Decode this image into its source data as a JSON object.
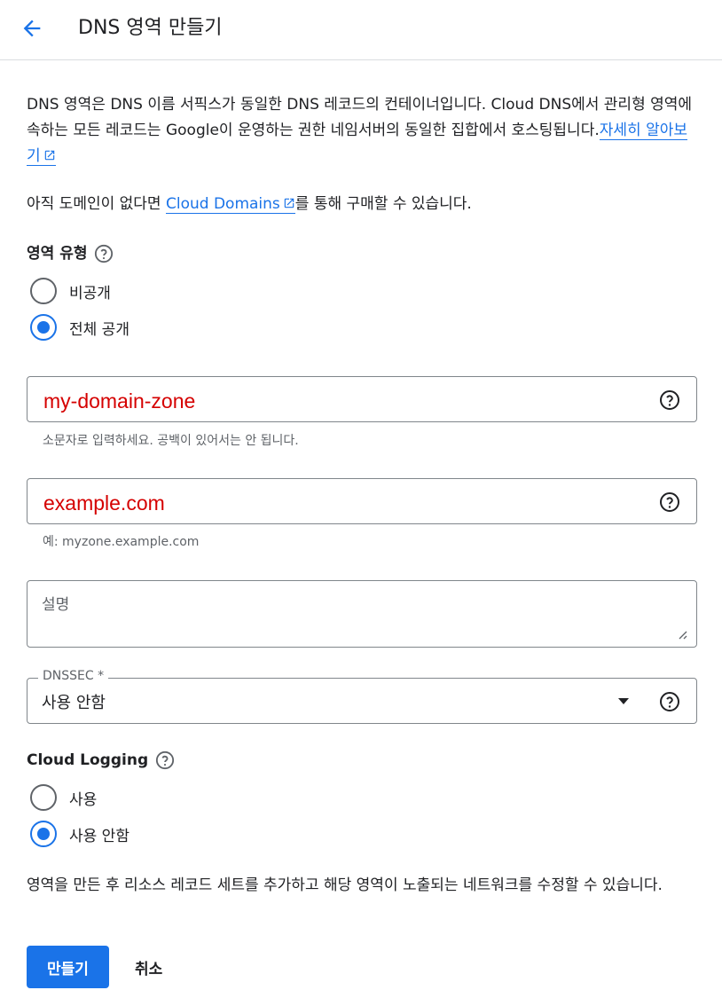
{
  "header": {
    "title": "DNS 영역 만들기"
  },
  "intro": {
    "text": "DNS 영역은 DNS 이름 서픽스가 동일한 DNS 레코드의 컨테이너입니다. Cloud DNS에서 관리형 영역에 속하는 모든 레코드는 Google이 운영하는 권한 네임서버의 동일한 집합에서 호스팅됩니다.",
    "learn_more": "자세히 알아보기"
  },
  "domains": {
    "prefix": "아직 도메인이 없다면 ",
    "link": "Cloud Domains",
    "suffix": "를 통해 구매할 수 있습니다."
  },
  "zone_type": {
    "label": "영역 유형",
    "options": [
      "비공개",
      "전체 공개"
    ],
    "selected": "전체 공개"
  },
  "zone_name": {
    "value": "my-domain-zone",
    "hint": "소문자로 입력하세요. 공백이 있어서는 안 됩니다."
  },
  "dns_name": {
    "value": "example.com",
    "hint": "예: myzone.example.com"
  },
  "description": {
    "placeholder": "설명"
  },
  "dnssec": {
    "label": "DNSSEC *",
    "value": "사용 안함"
  },
  "logging": {
    "label": "Cloud Logging",
    "options": [
      "사용",
      "사용 안함"
    ],
    "selected": "사용 안함"
  },
  "footer": {
    "text": "영역을 만든 후 리소스 레코드 세트를 추가하고 해당 영역이 노출되는 네트워크를 수정할 수 있습니다."
  },
  "actions": {
    "create": "만들기",
    "cancel": "취소"
  },
  "colors": {
    "accent": "#1a73e8",
    "input_text": "#d50000"
  }
}
